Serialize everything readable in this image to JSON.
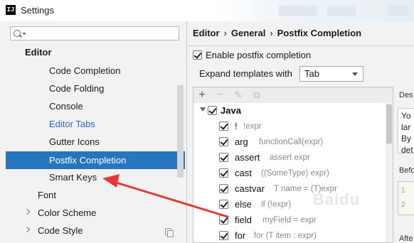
{
  "window": {
    "logo_text": "IJ",
    "title": "Settings"
  },
  "sidebar": {
    "search_placeholder": "",
    "section": "Editor",
    "items": [
      {
        "label": "Code Completion"
      },
      {
        "label": "Code Folding"
      },
      {
        "label": "Console"
      },
      {
        "label": "Editor Tabs"
      },
      {
        "label": "Gutter Icons"
      },
      {
        "label": "Postfix Completion"
      },
      {
        "label": "Smart Keys"
      }
    ],
    "top_items": [
      {
        "label": "Font"
      },
      {
        "label": "Color Scheme"
      },
      {
        "label": "Code Style"
      }
    ]
  },
  "breadcrumb": {
    "parts": [
      "Editor",
      "General",
      "Postfix Completion"
    ],
    "sep": "›"
  },
  "settings": {
    "enable_label": "Enable postfix completion",
    "enable_checked": true,
    "expand_label": "Expand templates with",
    "expand_value": "Tab"
  },
  "toolbar": {
    "add": "+",
    "remove": "−",
    "edit": "✎",
    "copy": "⧉"
  },
  "templates": {
    "group": "Java",
    "items": [
      {
        "name": "!",
        "hint": "!expr"
      },
      {
        "name": "arg",
        "hint": "functionCall(expr)"
      },
      {
        "name": "assert",
        "hint": "assert expr"
      },
      {
        "name": "cast",
        "hint": "((SomeType) expr)"
      },
      {
        "name": "castvar",
        "hint": "T name = (T)expr"
      },
      {
        "name": "else",
        "hint": "if (!expr)"
      },
      {
        "name": "field",
        "hint": "myField = expr"
      },
      {
        "name": "for",
        "hint": "for (T item : expr)"
      }
    ]
  },
  "side": {
    "desc_label": "Des",
    "desc_lines": [
      "Yo",
      "lar",
      "By",
      "det"
    ],
    "before_label": "Befo",
    "before_lines": [
      "1",
      "2"
    ],
    "after_label": "Afte"
  },
  "watermark": "Baidu"
}
